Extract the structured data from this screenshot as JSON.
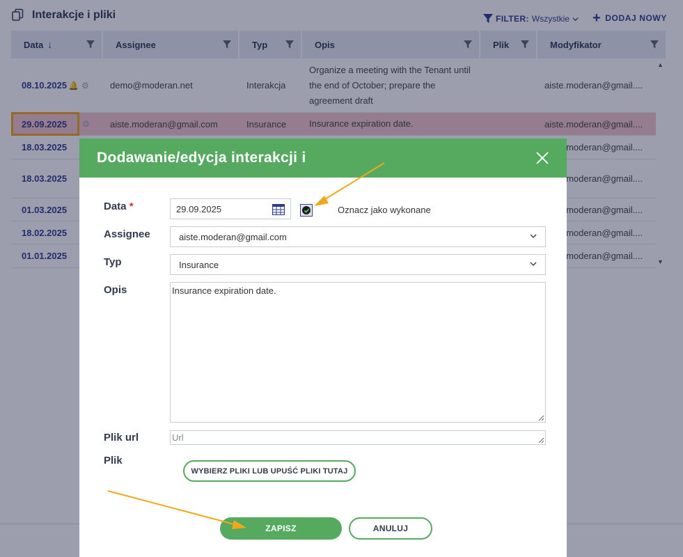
{
  "page": {
    "title": "Interakcje i pliki",
    "filter_label": "FILTER:",
    "filter_value": "Wszystkie",
    "add_new_label": "DODAJ NOWY"
  },
  "grid": {
    "columns": [
      {
        "label": "Data",
        "sorted": "desc"
      },
      {
        "label": "Assignee"
      },
      {
        "label": "Typ"
      },
      {
        "label": "Opis"
      },
      {
        "label": "Plik"
      },
      {
        "label": "Modyfikator"
      }
    ],
    "rows": [
      {
        "date": "08.10.2025",
        "assignee": "demo@moderan.net",
        "type": "Interakcja",
        "description": "Organize a meeting with the Tenant until the end of October; prepare the agreement draft",
        "modifier": "aiste.moderan@gmail....",
        "has_bell": true
      },
      {
        "date": "29.09.2025",
        "assignee": "aiste.moderan@gmail.com",
        "type": "Insurance",
        "description": "Insurance expiration date.",
        "modifier": "aiste.moderan@gmail....",
        "selected": true
      },
      {
        "date": "18.03.2025",
        "assignee": "",
        "type": "",
        "description": "",
        "modifier": "aiste.moderan@gmail...."
      },
      {
        "date": "18.03.2025",
        "assignee": "",
        "type": "",
        "description": "",
        "modifier": "aiste.moderan@gmail...."
      },
      {
        "date": "01.03.2025",
        "assignee": "",
        "type": "",
        "description": "",
        "modifier": "aiste.moderan@gmail...."
      },
      {
        "date": "18.02.2025",
        "assignee": "",
        "type": "",
        "description": "",
        "modifier": "aiste.moderan@gmail...."
      },
      {
        "date": "01.01.2025",
        "assignee": "",
        "type": "",
        "description": "",
        "modifier": "aiste.moderan@gmail...."
      }
    ]
  },
  "modal": {
    "title": "Dodawanie/edycja interakcji i",
    "date_label": "Data",
    "required_mark": "*",
    "date_value": "29.09.2025",
    "done_label": "Oznacz jako wykonane",
    "done_checked": true,
    "assignee_label": "Assignee",
    "assignee_value": "aiste.moderan@gmail.com",
    "type_label": "Typ",
    "type_value": "Insurance",
    "description_label": "Opis",
    "description_value": "Insurance expiration date.",
    "url_label": "Plik url",
    "url_placeholder": "Url",
    "file_label": "Plik",
    "upload_label": "WYBIERZ PLIKI LUB UPUŚĆ PLIKI TUTAJ",
    "save_label": "ZAPISZ",
    "cancel_label": "ANULUJ"
  },
  "colors": {
    "modal_header": "#55aa60",
    "selected_row": "#f5c5cc",
    "highlight_box": "#f0a818",
    "arrow": "#f0a818",
    "link_blue": "#2e3d8f"
  },
  "icons": [
    "copy-icon",
    "filter-icon",
    "plus-icon",
    "sort-desc-icon",
    "column-filter-icon",
    "bell-icon",
    "gear-icon",
    "close-icon",
    "calendar-icon",
    "checkbox-checked-icon",
    "chevron-down-icon",
    "resize-grip-icon",
    "arrow-annotation-icon"
  ]
}
